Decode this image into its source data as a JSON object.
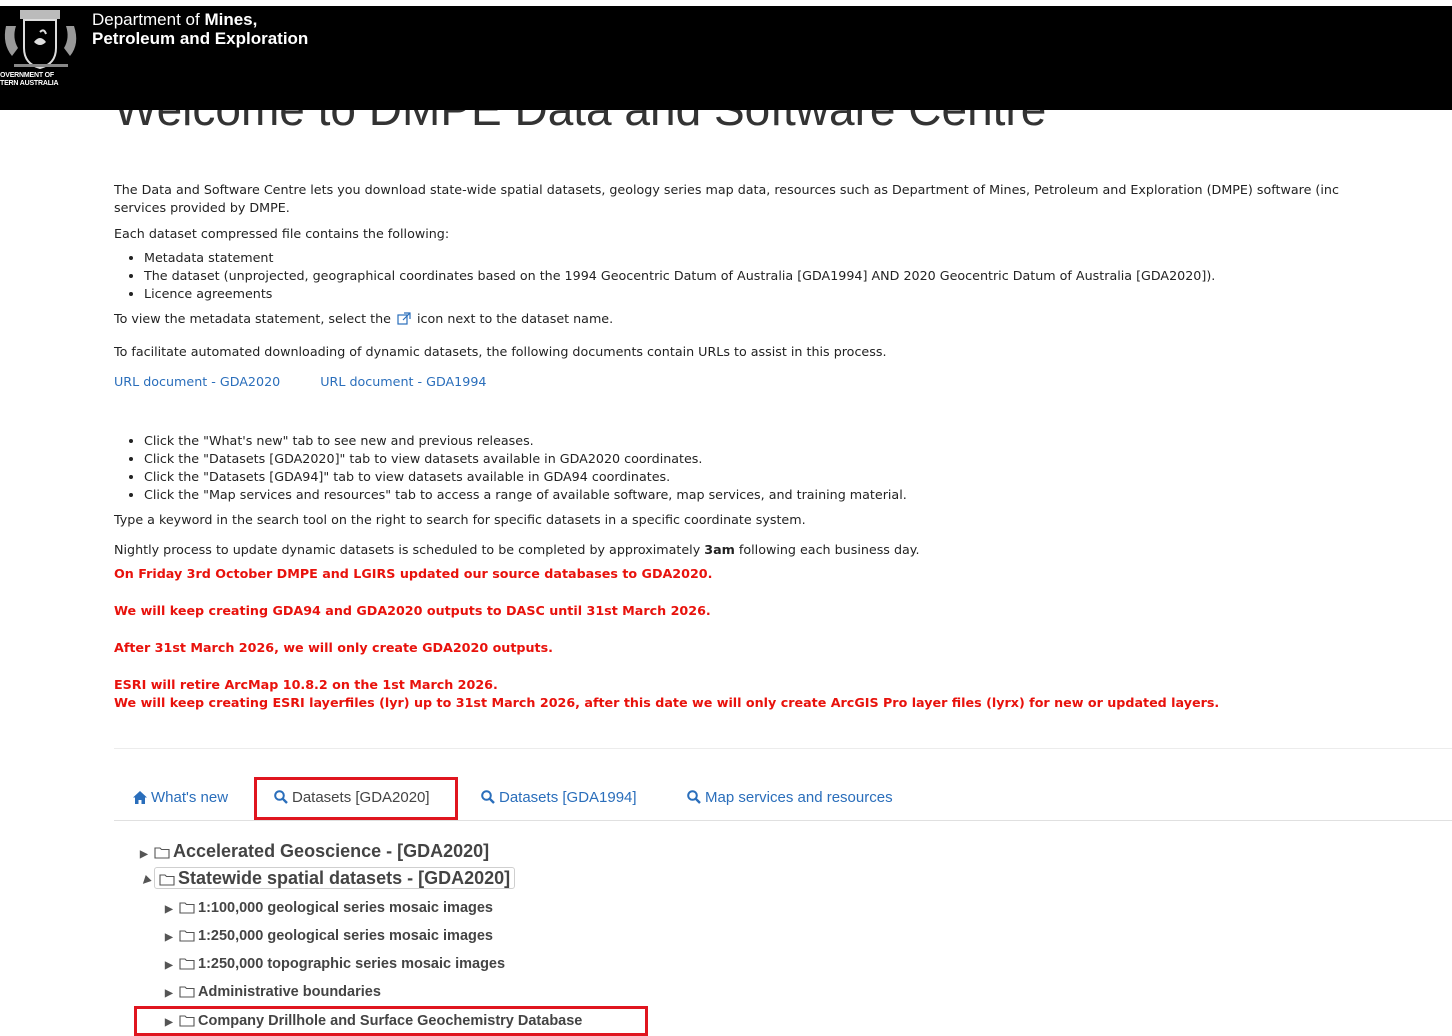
{
  "header": {
    "dept_line1_prefix": "Department of ",
    "dept_line1_bold": "Mines,",
    "dept_line2": "Petroleum and Exploration",
    "gov_line1": "OVERNMENT OF",
    "gov_line2": "TERN AUSTRALIA"
  },
  "page_title": "Welcome to DMPE Data and Software Centre",
  "intro": {
    "line1": "The Data and Software Centre lets you download state-wide spatial datasets, geology series map data, resources such as Department of Mines, Petroleum and Exploration (DMPE) software (inc",
    "line2": "services provided by DMPE."
  },
  "contains_label": "Each dataset compressed file contains the following:",
  "contains_items": [
    "Metadata statement",
    "The dataset (unprojected, geographical coordinates based on the 1994 Geocentric Datum of Australia [GDA1994] AND 2020 Geocentric Datum of Australia [GDA2020]).",
    "Licence agreements"
  ],
  "metadata_hint_before": "To view the metadata statement, select the ",
  "metadata_hint_after": " icon next to the dataset name.",
  "automation_text": "To facilitate automated downloading of dynamic datasets, the following documents contain URLs to assist in this process.",
  "url_links": [
    "URL document - GDA2020",
    "URL document - GDA1994"
  ],
  "tab_hints": [
    "Click the \"What's new\" tab to see new and previous releases.",
    "Click the \"Datasets [GDA2020]\" tab to view datasets available in GDA2020 coordinates.",
    "Click the \"Datasets [GDA94]\" tab to view datasets available in GDA94 coordinates.",
    "Click the \"Map services and resources\" tab to access a range of available software, map services, and training material."
  ],
  "search_hint": "Type a keyword in the search tool on the right to search for specific datasets in a specific coordinate system.",
  "nightly_before": "Nightly process to update dynamic datasets is scheduled to be completed by approximately ",
  "nightly_bold": "3am",
  "nightly_after": " following each business day.",
  "notices": [
    "On Friday 3rd October DMPE and LGIRS updated our source databases to GDA2020.",
    "We will keep creating GDA94 and GDA2020 outputs to DASC until 31st March 2026.",
    "After 31st March 2026, we will only create GDA2020 outputs.",
    "ESRI will retire ArcMap 10.8.2 on the 1st March 2026.",
    "We will keep creating ESRI layerfiles (lyr) up to 31st March 2026, after this date we will only create ArcGIS Pro layer files (lyrx) for new or updated layers."
  ],
  "tabs": [
    "What's new",
    "Datasets [GDA2020]",
    "Datasets [GDA1994]",
    "Map services and resources"
  ],
  "active_tab": "Datasets [GDA2020]",
  "tree": {
    "accelerated": "Accelerated Geoscience - [GDA2020]",
    "statewide": "Statewide spatial datasets - [GDA2020]",
    "children": [
      "1:100,000 geological series mosaic images",
      "1:250,000 geological series mosaic images",
      "1:250,000 topographic series mosaic images",
      "Administrative boundaries",
      "Company Drillhole and Surface Geochemistry Database"
    ]
  },
  "colors": {
    "link": "#2a6ebb",
    "notice": "#e8120c",
    "highlight": "#e0151f",
    "header_bg": "#000000"
  }
}
